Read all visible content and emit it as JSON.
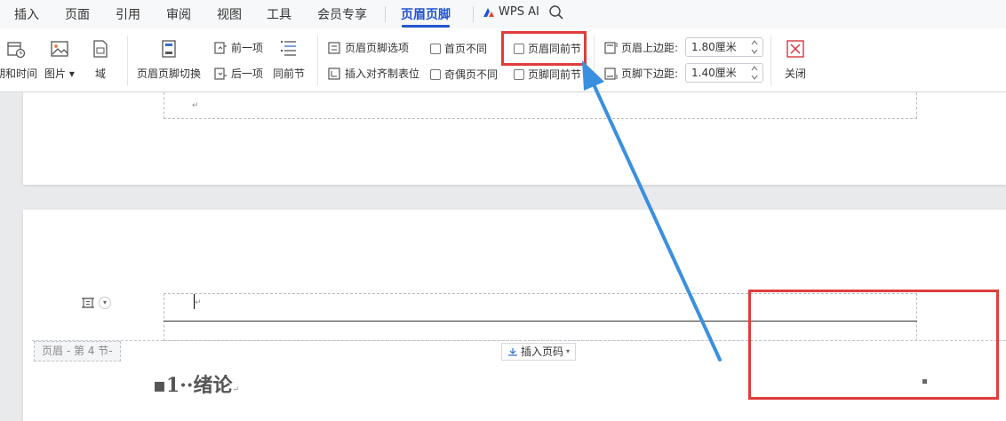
{
  "menu": {
    "items": [
      "插入",
      "页面",
      "引用",
      "审阅",
      "视图",
      "工具",
      "会员专享",
      "页眉页脚"
    ],
    "active": "页眉页脚",
    "wps_ai": "WPS AI"
  },
  "ribbon": {
    "date_time": "期和时间",
    "picture": "图片",
    "field": "域",
    "switch": "页眉页脚切换",
    "prev": "前一项",
    "next": "后一项",
    "same_as_prev": "同前节",
    "options": "页眉页脚选项",
    "insert_align_tab": "插入对齐制表位",
    "first_page_diff": "首页不同",
    "odd_even_diff": "奇偶页不同",
    "header_same_prev": "页眉同前节",
    "footer_same_prev": "页脚同前节",
    "header_top_label": "页眉上边距:",
    "header_top_value": "1.80厘米",
    "footer_bottom_label": "页脚下边距:",
    "footer_bottom_value": "1.40厘米",
    "close": "关闭"
  },
  "document": {
    "section_tag": "页眉 - 第 4 节-",
    "insert_page_number": "插入页码",
    "heading": "▪1··绪论",
    "paragraph_mark": "↵"
  },
  "colors": {
    "accent": "#2355d0",
    "annotation_red": "#e03c3c",
    "arrow_blue": "#3b8fe0"
  }
}
